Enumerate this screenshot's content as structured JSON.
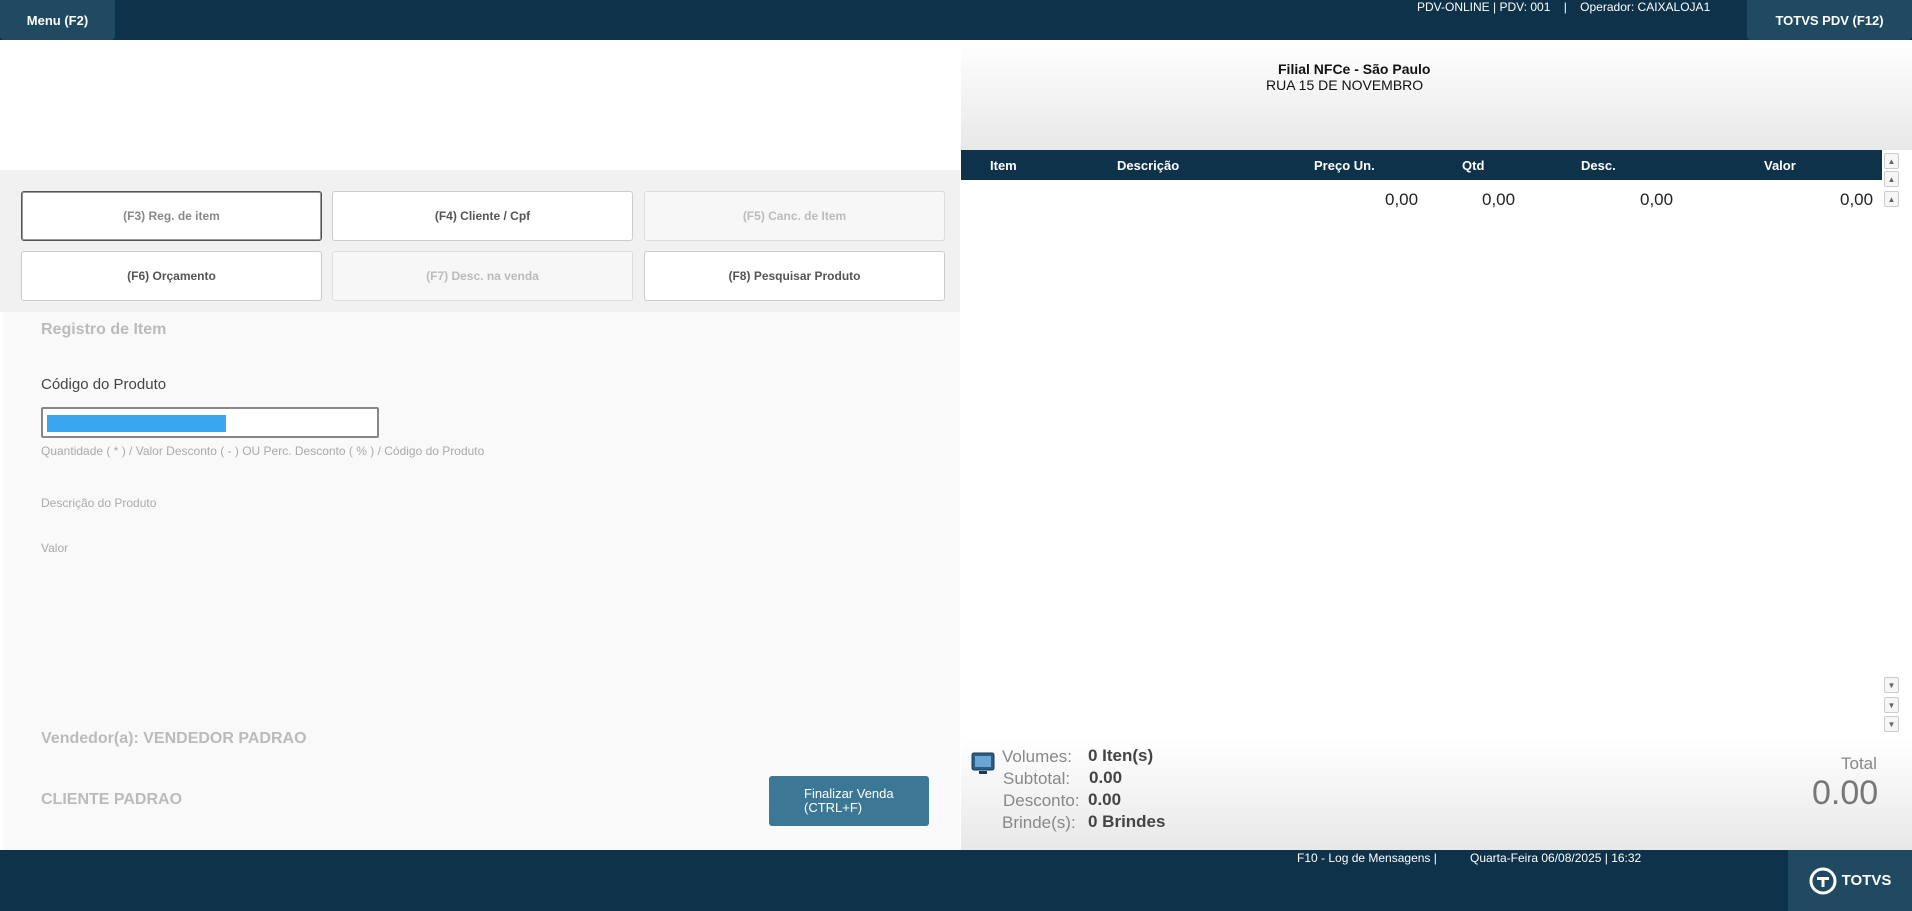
{
  "topbar": {
    "menu_label": "Menu (F2)",
    "status": "PDV-ONLINE | PDV: 001    |    Operador: CAIXALOJA1",
    "totvs_label": "TOTVS PDV (F12)"
  },
  "functions": [
    {
      "label": "(F3) Reg. de item"
    },
    {
      "label": "(F4) Cliente / Cpf"
    },
    {
      "label": "(F5) Canc. de Item"
    },
    {
      "label": "(F6) Orçamento"
    },
    {
      "label": "(F7) Desc. na venda"
    },
    {
      "label": "(F8) Pesquisar Produto"
    }
  ],
  "register": {
    "title": "Registro de Item",
    "code_label": "Código do Produto",
    "hint": "Quantidade ( * ) / Valor Desconto ( - ) OU Perc. Desconto ( % ) / Código do Produto",
    "desc_label": "Descrição do Produto",
    "value_label": "Valor",
    "seller": "Vendedor(a): VENDEDOR PADRAO",
    "client": "CLIENTE PADRAO",
    "finalize_line1": "Finalizar Venda",
    "finalize_line2": "(CTRL+F)"
  },
  "store": {
    "name": "Filial NFCe - São Paulo",
    "address": "RUA 15 DE NOVEMBRO"
  },
  "table": {
    "headers": {
      "item": "Item",
      "desc": "Descrição",
      "price": "Preço Un.",
      "qty": "Qtd",
      "discount": "Desc.",
      "value": "Valor"
    },
    "row": {
      "price": "0,00",
      "qty": "0,00",
      "discount": "0,00",
      "value": "0,00"
    }
  },
  "summary": {
    "volumes_label": "Volumes:",
    "volumes_value": "0 Iten(s)",
    "subtotal_label": "Subtotal:",
    "subtotal_value": "0.00",
    "discount_label": "Desconto:",
    "discount_value": "0.00",
    "gifts_label": "Brinde(s):",
    "gifts_value": "0 Brindes",
    "total_label": "Total",
    "total_value": "0.00"
  },
  "bottombar": {
    "log": "F10 - Log de Mensagens |",
    "datetime": "Quarta-Feira 06/08/2025 | 16:32",
    "brand": "TOTVS"
  },
  "colors": {
    "navy": "#0d3249",
    "button_blue": "#3b7896",
    "selection": "#3aa6f0"
  }
}
